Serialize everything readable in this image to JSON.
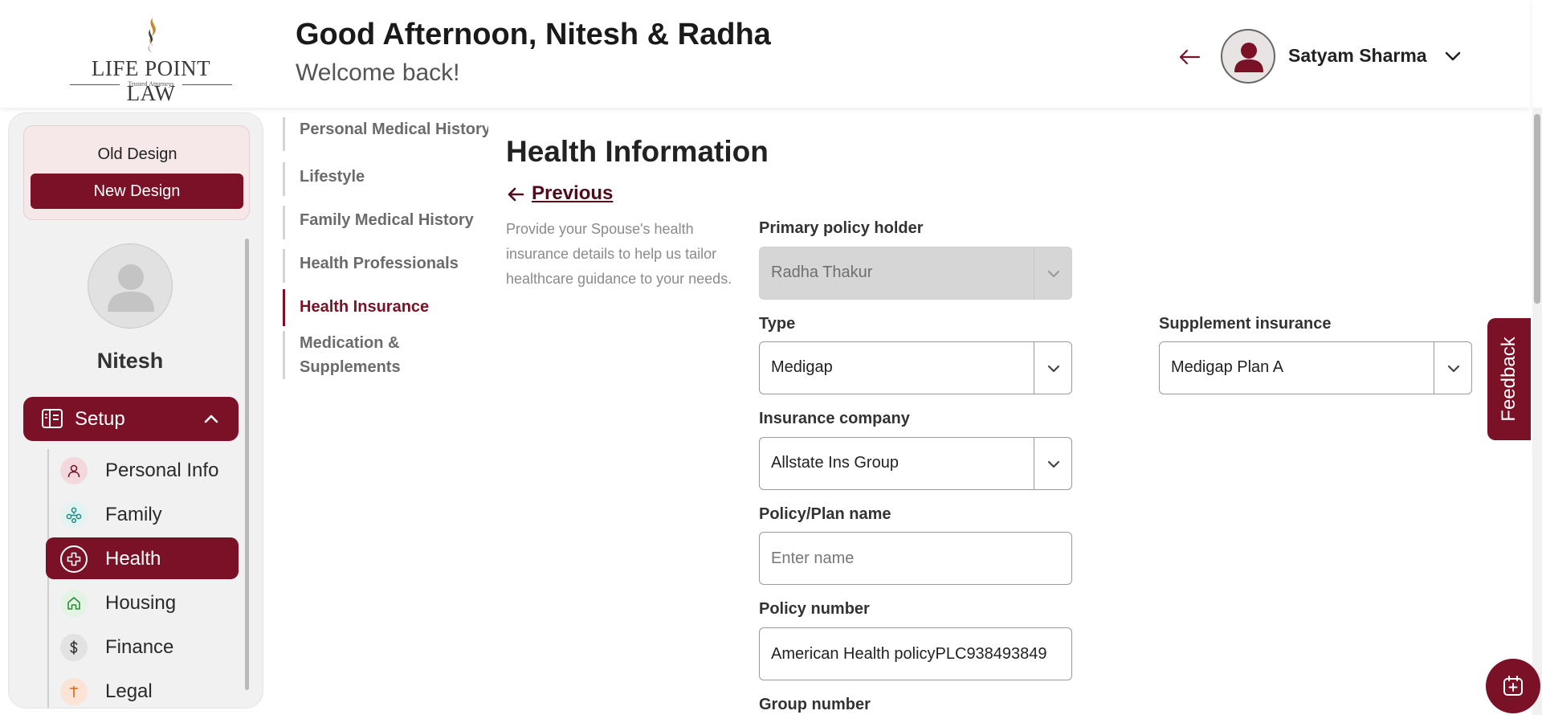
{
  "brand": {
    "logo_text": "LIFE POINT LAW",
    "tagline": "Trusted Attorneys"
  },
  "header": {
    "greeting": "Good Afternoon, Nitesh & Radha",
    "subtitle": "Welcome back!",
    "back_icon": "arrow-left-icon",
    "user_name": "Satyam Sharma",
    "user_menu_icon": "chevron-down-icon"
  },
  "sidebar": {
    "old_design_label": "Old Design",
    "new_design_label": "New Design",
    "profile_name": "Nitesh",
    "setup_label": "Setup",
    "items": [
      {
        "label": "Personal Info",
        "icon": "person-icon",
        "active": false
      },
      {
        "label": "Family",
        "icon": "family-tree-icon",
        "active": false
      },
      {
        "label": "Health",
        "icon": "medical-cross-icon",
        "active": true
      },
      {
        "label": "Housing",
        "icon": "home-icon",
        "active": false
      },
      {
        "label": "Finance",
        "icon": "dollar-icon",
        "active": false
      },
      {
        "label": "Legal",
        "icon": "legal-icon",
        "active": false
      }
    ]
  },
  "subnav": {
    "items": [
      {
        "label": "Personal Medical History",
        "active": false
      },
      {
        "label": "Lifestyle",
        "active": false
      },
      {
        "label": "Family Medical History",
        "active": false
      },
      {
        "label": "Health Professionals",
        "active": false
      },
      {
        "label": "Health Insurance",
        "active": true
      },
      {
        "label": "Medication &",
        "label2": "Supplements",
        "active": false
      }
    ]
  },
  "main": {
    "title": "Health Information",
    "previous_label": "Previous",
    "description": "Provide your Spouse's health insurance details to help us tailor healthcare guidance to your needs.",
    "fields": {
      "primary_holder": {
        "label": "Primary policy holder",
        "value": "Radha Thakur"
      },
      "type": {
        "label": "Type",
        "value": "Medigap"
      },
      "supplement": {
        "label": "Supplement insurance",
        "value": "Medigap Plan A"
      },
      "company": {
        "label": "Insurance company",
        "value": "Allstate Ins Group"
      },
      "plan_name": {
        "label": "Policy/Plan name",
        "value": "",
        "placeholder": "Enter name"
      },
      "policy_number": {
        "label": "Policy number",
        "value": "American Health policyPLC938493849"
      },
      "group_number": {
        "label": "Group number"
      }
    }
  },
  "widgets": {
    "feedback_label": "Feedback",
    "fab_icon": "add-note-icon"
  },
  "colors": {
    "accent": "#7a1126",
    "muted_text": "#8a8a8a"
  }
}
